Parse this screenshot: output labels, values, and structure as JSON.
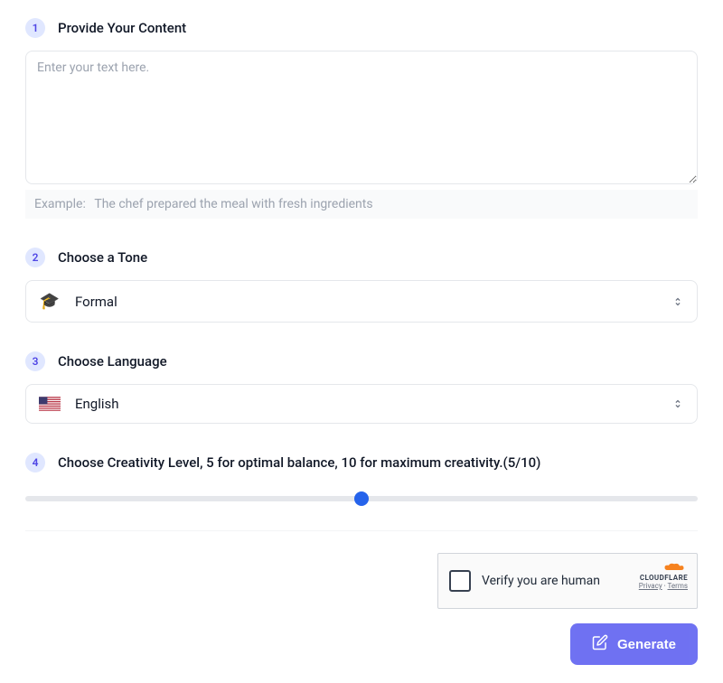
{
  "step1": {
    "number": "1",
    "title": "Provide Your Content",
    "placeholder": "Enter your text here.",
    "value": "",
    "example_label": "Example:",
    "example_text": "The chef prepared the meal with fresh ingredients"
  },
  "step2": {
    "number": "2",
    "title": "Choose a Tone",
    "icon": "🎓",
    "value": "Formal"
  },
  "step3": {
    "number": "3",
    "title": "Choose Language",
    "value": "English"
  },
  "step4": {
    "number": "4",
    "title": "Choose Creativity Level, 5 for optimal balance, 10 for maximum creativity.(5/10)",
    "value": 5,
    "min": 0,
    "max": 10
  },
  "captcha": {
    "text": "Verify you are human",
    "brand": "CLOUDFLARE",
    "privacy": "Privacy",
    "terms": "Terms"
  },
  "generate": {
    "label": "Generate"
  }
}
